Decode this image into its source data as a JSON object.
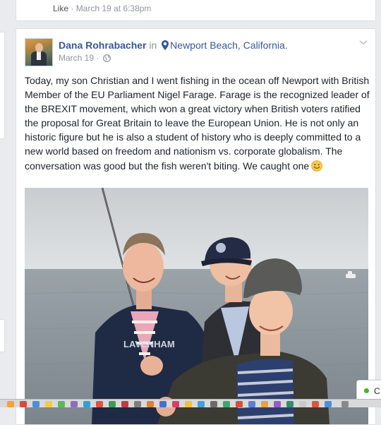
{
  "previous_post": {
    "like_label": "Like",
    "separator": " · ",
    "timestamp": "March 19 at 6:38pm"
  },
  "post": {
    "author": "Dana Rohrabacher",
    "in_word": "in",
    "location": "Newport Beach, California.",
    "date": "March 19",
    "date_separator": " · ",
    "text": "Today, my son Christian and I went fishing in the ocean off Newport with British Member of the EU Parliament Nigel Farage. Farage is the recognized leader of the BREXIT movement, which won a great victory when British voters ratified the proposal for Great Britain to leave the European Union. He is not only an historic figure but he is also a student of history who is deeply committed to a new world based on freedom and nationism vs. corporate globalism. The conversation was good but the fish weren't biting. We caught one",
    "emoji_icon": "smile-icon",
    "photo_icon": "fishing-photo",
    "sweatshirt_text": "LAVENHAM"
  },
  "chat": {
    "label": "C"
  },
  "colors": {
    "link": "#365899",
    "meta": "#90949c",
    "text": "#1d2129",
    "online": "#42b72a"
  }
}
